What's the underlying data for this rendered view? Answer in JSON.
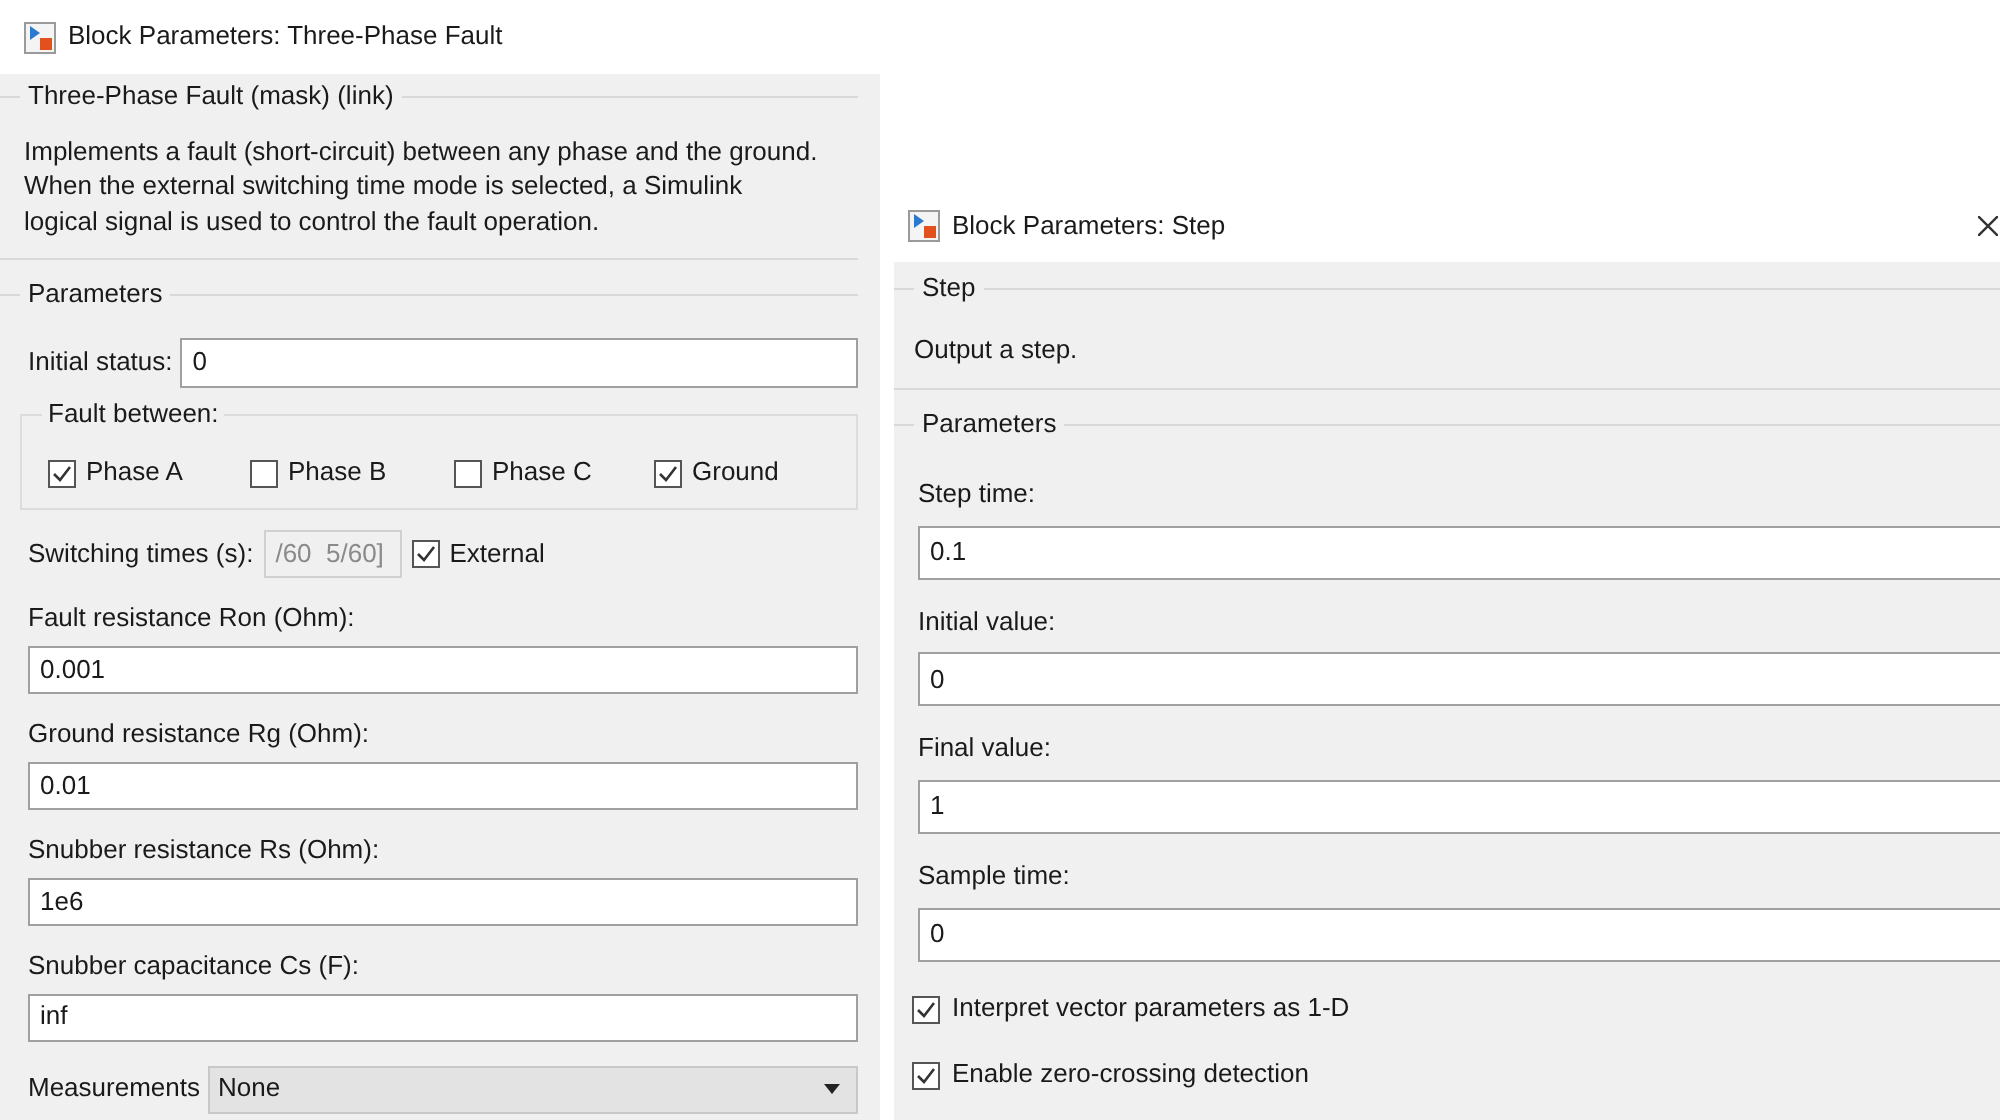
{
  "fault_dialog": {
    "title": "Block Parameters: Three-Phase Fault",
    "description_heading": "Three-Phase Fault (mask) (link)",
    "description": "Implements a fault (short-circuit) between any phase and the ground. When the external switching time mode is selected, a Simulink logical signal is used to control the fault operation.",
    "parameters_heading": "Parameters",
    "initial_status": {
      "label": "Initial status:",
      "value": "0"
    },
    "fault_between": {
      "label": "Fault between:",
      "options": [
        {
          "label": "Phase A",
          "checked": true
        },
        {
          "label": "Phase B",
          "checked": false
        },
        {
          "label": "Phase C",
          "checked": false
        },
        {
          "label": "Ground",
          "checked": true
        }
      ]
    },
    "switching_times": {
      "label": "Switching times (s):",
      "value": "/60  5/60]",
      "disabled": true
    },
    "external": {
      "label": "External",
      "checked": true
    },
    "fields": [
      {
        "label": "Fault resistance Ron (Ohm):",
        "value": "0.001"
      },
      {
        "label": "Ground resistance Rg (Ohm):",
        "value": "0.01"
      },
      {
        "label": "Snubber resistance Rs (Ohm):",
        "value": "1e6"
      },
      {
        "label": "Snubber capacitance Cs (F):",
        "value": "inf"
      }
    ],
    "measurements": {
      "label": "Measurements",
      "value": "None"
    }
  },
  "step_dialog": {
    "title": "Block Parameters: Step",
    "description_heading": "Step",
    "description": "Output a step.",
    "parameters_heading": "Parameters",
    "fields": [
      {
        "label": "Step time:",
        "value": "0.1"
      },
      {
        "label": "Initial value:",
        "value": "0"
      },
      {
        "label": "Final value:",
        "value": "1"
      },
      {
        "label": "Sample time:",
        "value": "0"
      }
    ],
    "options": [
      {
        "label": "Interpret vector parameters as 1-D",
        "checked": true
      },
      {
        "label": "Enable zero-crossing detection",
        "checked": true
      }
    ]
  }
}
